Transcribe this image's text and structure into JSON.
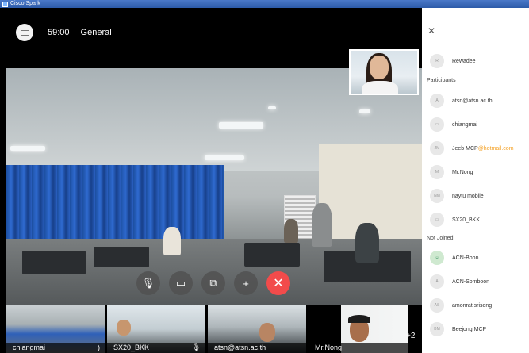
{
  "window": {
    "title": "Cisco Spark"
  },
  "call": {
    "timer": "59:00",
    "space_name": "General",
    "menu_icon": "menu-icon"
  },
  "controls": [
    {
      "name": "mute-button",
      "icon": "microphone-off-icon",
      "glyph": "🎙"
    },
    {
      "name": "video-off-button",
      "icon": "camera-off-icon",
      "glyph": "▭"
    },
    {
      "name": "share-screen-button",
      "icon": "share-screen-icon",
      "glyph": "⧉"
    },
    {
      "name": "add-participant-button",
      "icon": "add-person-icon",
      "glyph": "+"
    },
    {
      "name": "end-call-button",
      "icon": "close-icon",
      "glyph": "✕"
    }
  ],
  "thumbnails": [
    {
      "label": "chiangmai",
      "mic_icon": ")"
    },
    {
      "label": "SX20_BKK",
      "mic_icon": "🎙"
    },
    {
      "label": "atsn@atsn.ac.th",
      "mic_icon": ""
    },
    {
      "label": "Mr.Nong",
      "mic_icon": ""
    }
  ],
  "more_count": "+2",
  "sidebar": {
    "close_icon": "close-icon",
    "host": {
      "avatar": "R",
      "name": "Rewadee"
    },
    "participants_header": "Participants",
    "participants": [
      {
        "avatar": "A",
        "name": "atsn@atsn.ac.th",
        "email_tail": ""
      },
      {
        "avatar": "▭",
        "name": "chiangmai",
        "email_tail": ""
      },
      {
        "avatar": "JM",
        "name": "Jeeb MCP",
        "email_tail": "@hotmail.com"
      },
      {
        "avatar": "M",
        "name": "Mr.Nong",
        "email_tail": ""
      },
      {
        "avatar": "NM",
        "name": "naytu mobile",
        "email_tail": ""
      },
      {
        "avatar": "▭",
        "name": "SX20_BKK",
        "email_tail": ""
      }
    ],
    "not_joined_header": "Not Joined",
    "not_joined": [
      {
        "avatar": "☺",
        "name": "ACN-Boon",
        "email_tail": "",
        "green": true
      },
      {
        "avatar": "A",
        "name": "ACN-Somboon",
        "email_tail": ""
      },
      {
        "avatar": "AS",
        "name": "amonrat srisong",
        "email_tail": ""
      },
      {
        "avatar": "BM",
        "name": "Beejong MCP",
        "email_tail": ""
      }
    ]
  },
  "colors": {
    "end_call": "#f24b4b",
    "curtain": "#2f6ad0",
    "email_highlight": "#f4a125"
  }
}
